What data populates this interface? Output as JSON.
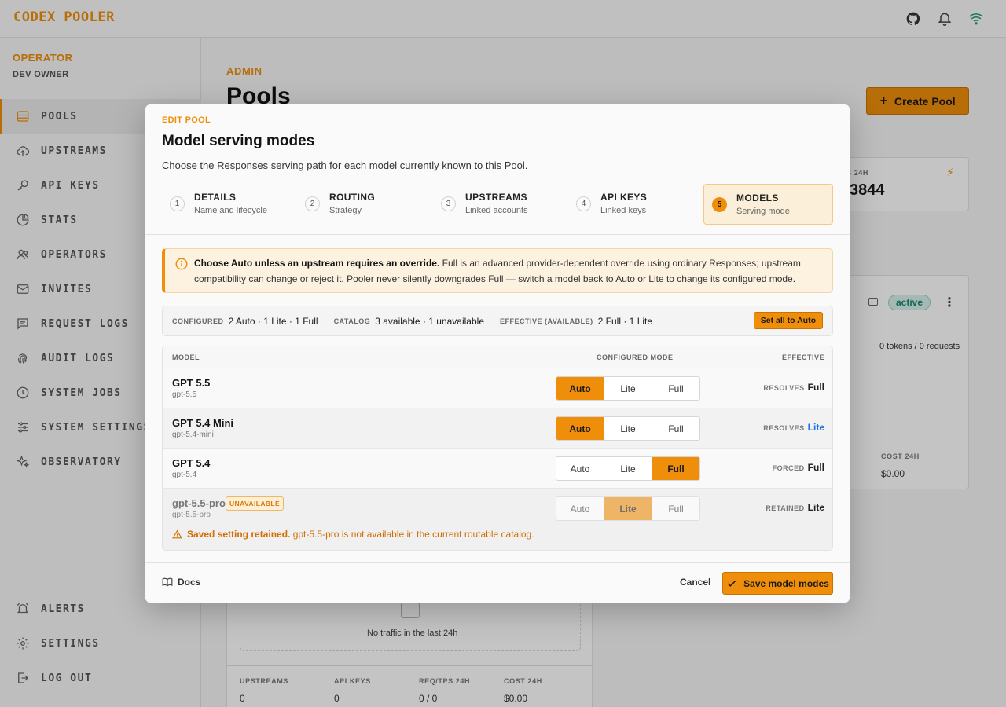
{
  "app": {
    "brand": "CODEX POOLER"
  },
  "operator": {
    "role": "OPERATOR",
    "name": "DEV OWNER"
  },
  "sidebar": {
    "items": [
      {
        "label": "POOLS",
        "icon": "database-icon",
        "active": true
      },
      {
        "label": "UPSTREAMS",
        "icon": "cloud-upload-icon"
      },
      {
        "label": "API KEYS",
        "icon": "key-icon"
      },
      {
        "label": "STATS",
        "icon": "pie-chart-icon"
      },
      {
        "label": "OPERATORS",
        "icon": "users-icon"
      },
      {
        "label": "INVITES",
        "icon": "mail-icon"
      },
      {
        "label": "REQUEST LOGS",
        "icon": "message-icon"
      },
      {
        "label": "AUDIT LOGS",
        "icon": "fingerprint-icon"
      },
      {
        "label": "SYSTEM JOBS",
        "icon": "clock-icon"
      },
      {
        "label": "SYSTEM SETTINGS",
        "icon": "sliders-icon"
      },
      {
        "label": "OBSERVATORY",
        "icon": "sparkles-icon"
      }
    ],
    "bottom": [
      {
        "label": "ALERTS",
        "icon": "alarm-icon"
      },
      {
        "label": "SETTINGS",
        "icon": "gear-icon"
      },
      {
        "label": "LOG OUT",
        "icon": "logout-icon"
      }
    ]
  },
  "main": {
    "eyebrow": "ADMIN",
    "title": "Pools",
    "create_label": "Create Pool",
    "stat_label": "S 24H",
    "stat_value": "3844",
    "status": "active",
    "tokens_text": "0 tokens / 0 requests",
    "cost_label": "COST 24H",
    "cost_value": "$0.00",
    "no_traffic": "No traffic in the last 24h",
    "footer_stats": [
      {
        "label": "UPSTREAMS",
        "value": "0"
      },
      {
        "label": "API KEYS",
        "value": "0"
      },
      {
        "label": "REQ/TPS 24H",
        "value": "0 / 0"
      },
      {
        "label": "COST 24H",
        "value": "$0.00"
      }
    ]
  },
  "modal": {
    "eyebrow": "EDIT POOL",
    "title": "Model serving modes",
    "description": "Choose the Responses serving path for each model currently known to this Pool.",
    "steps": [
      {
        "num": "1",
        "title": "DETAILS",
        "sub": "Name and lifecycle"
      },
      {
        "num": "2",
        "title": "ROUTING",
        "sub": "Strategy"
      },
      {
        "num": "3",
        "title": "UPSTREAMS",
        "sub": "Linked accounts"
      },
      {
        "num": "4",
        "title": "API KEYS",
        "sub": "Linked keys"
      },
      {
        "num": "5",
        "title": "MODELS",
        "sub": "Serving mode",
        "active": true
      }
    ],
    "warning": {
      "bold": "Choose Auto unless an upstream requires an override.",
      "text": " Full is an advanced provider-dependent override using ordinary Responses; upstream compatibility can change or reject it. Pooler never silently downgrades Full — switch a model back to Auto or Lite to change its configured mode."
    },
    "summary": {
      "configured_label": "CONFIGURED",
      "configured_value": "2 Auto · 1 Lite · 1 Full",
      "catalog_label": "CATALOG",
      "catalog_value": "3 available · 1 unavailable",
      "effective_label": "EFFECTIVE (AVAILABLE)",
      "effective_value": "2 Full · 1 Lite",
      "set_all_label": "Set all to Auto"
    },
    "table": {
      "headers": {
        "model": "MODEL",
        "mode": "CONFIGURED MODE",
        "effective": "EFFECTIVE"
      },
      "mode_options": [
        "Auto",
        "Lite",
        "Full"
      ],
      "rows": [
        {
          "name": "GPT 5.5",
          "id": "gpt-5.5",
          "mode": "Auto",
          "eff_label": "RESOLVES",
          "eff_value": "Full"
        },
        {
          "name": "GPT 5.4 Mini",
          "id": "gpt-5.4-mini",
          "mode": "Auto",
          "eff_label": "RESOLVES",
          "eff_value": "Lite"
        },
        {
          "name": "GPT 5.4",
          "id": "gpt-5.4",
          "mode": "Full",
          "eff_label": "FORCED",
          "eff_value": "Full"
        },
        {
          "name": "gpt-5.5-pro",
          "id": "gpt-5.5-pro",
          "mode": "Lite",
          "eff_label": "RETAINED",
          "eff_value": "Lite",
          "badge": "UNAVAILABLE",
          "note_bold": "Saved setting retained.",
          "note_text": " gpt-5.5-pro is not available in the current routable catalog."
        }
      ]
    },
    "footer": {
      "docs": "Docs",
      "cancel": "Cancel",
      "save": "Save model modes"
    }
  },
  "colors": {
    "accent": "#ef8e0b",
    "blue": "#1a73e8",
    "warn": "#d26d00"
  }
}
